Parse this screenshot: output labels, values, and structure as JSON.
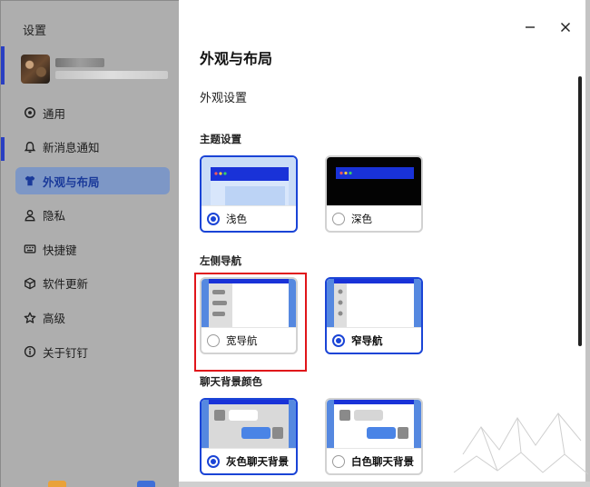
{
  "window": {
    "title": "设置"
  },
  "sidebar": {
    "items": [
      {
        "key": "general",
        "label": "通用",
        "icon": "settings-circle-icon",
        "active": false
      },
      {
        "key": "notifications",
        "label": "新消息通知",
        "icon": "bell-icon",
        "active": false
      },
      {
        "key": "appearance",
        "label": "外观与布局",
        "icon": "shirt-icon",
        "active": true
      },
      {
        "key": "privacy",
        "label": "隐私",
        "icon": "user-icon",
        "active": false
      },
      {
        "key": "shortcuts",
        "label": "快捷键",
        "icon": "keyboard-icon",
        "active": false
      },
      {
        "key": "updates",
        "label": "软件更新",
        "icon": "cube-icon",
        "active": false
      },
      {
        "key": "advanced",
        "label": "高级",
        "icon": "star-icon",
        "active": false
      },
      {
        "key": "about",
        "label": "关于钉钉",
        "icon": "info-icon",
        "active": false
      }
    ]
  },
  "main": {
    "title": "外观与布局",
    "section": "外观设置",
    "theme": {
      "title": "主题设置",
      "options": [
        {
          "label": "浅色",
          "selected": true
        },
        {
          "label": "深色",
          "selected": false
        }
      ]
    },
    "left_nav": {
      "title": "左侧导航",
      "options": [
        {
          "label": "宽导航",
          "selected": false
        },
        {
          "label": "窄导航",
          "selected": true
        }
      ]
    },
    "chat_bg": {
      "title": "聊天背景颜色",
      "options": [
        {
          "label": "灰色聊天背景",
          "selected": true
        },
        {
          "label": "白色聊天背景",
          "selected": false
        }
      ]
    }
  },
  "colors": {
    "accent": "#1a44d6",
    "highlight": "#e0151a",
    "sidebar_bg": "#aeaeae",
    "active_item_bg": "#7d97c6"
  }
}
